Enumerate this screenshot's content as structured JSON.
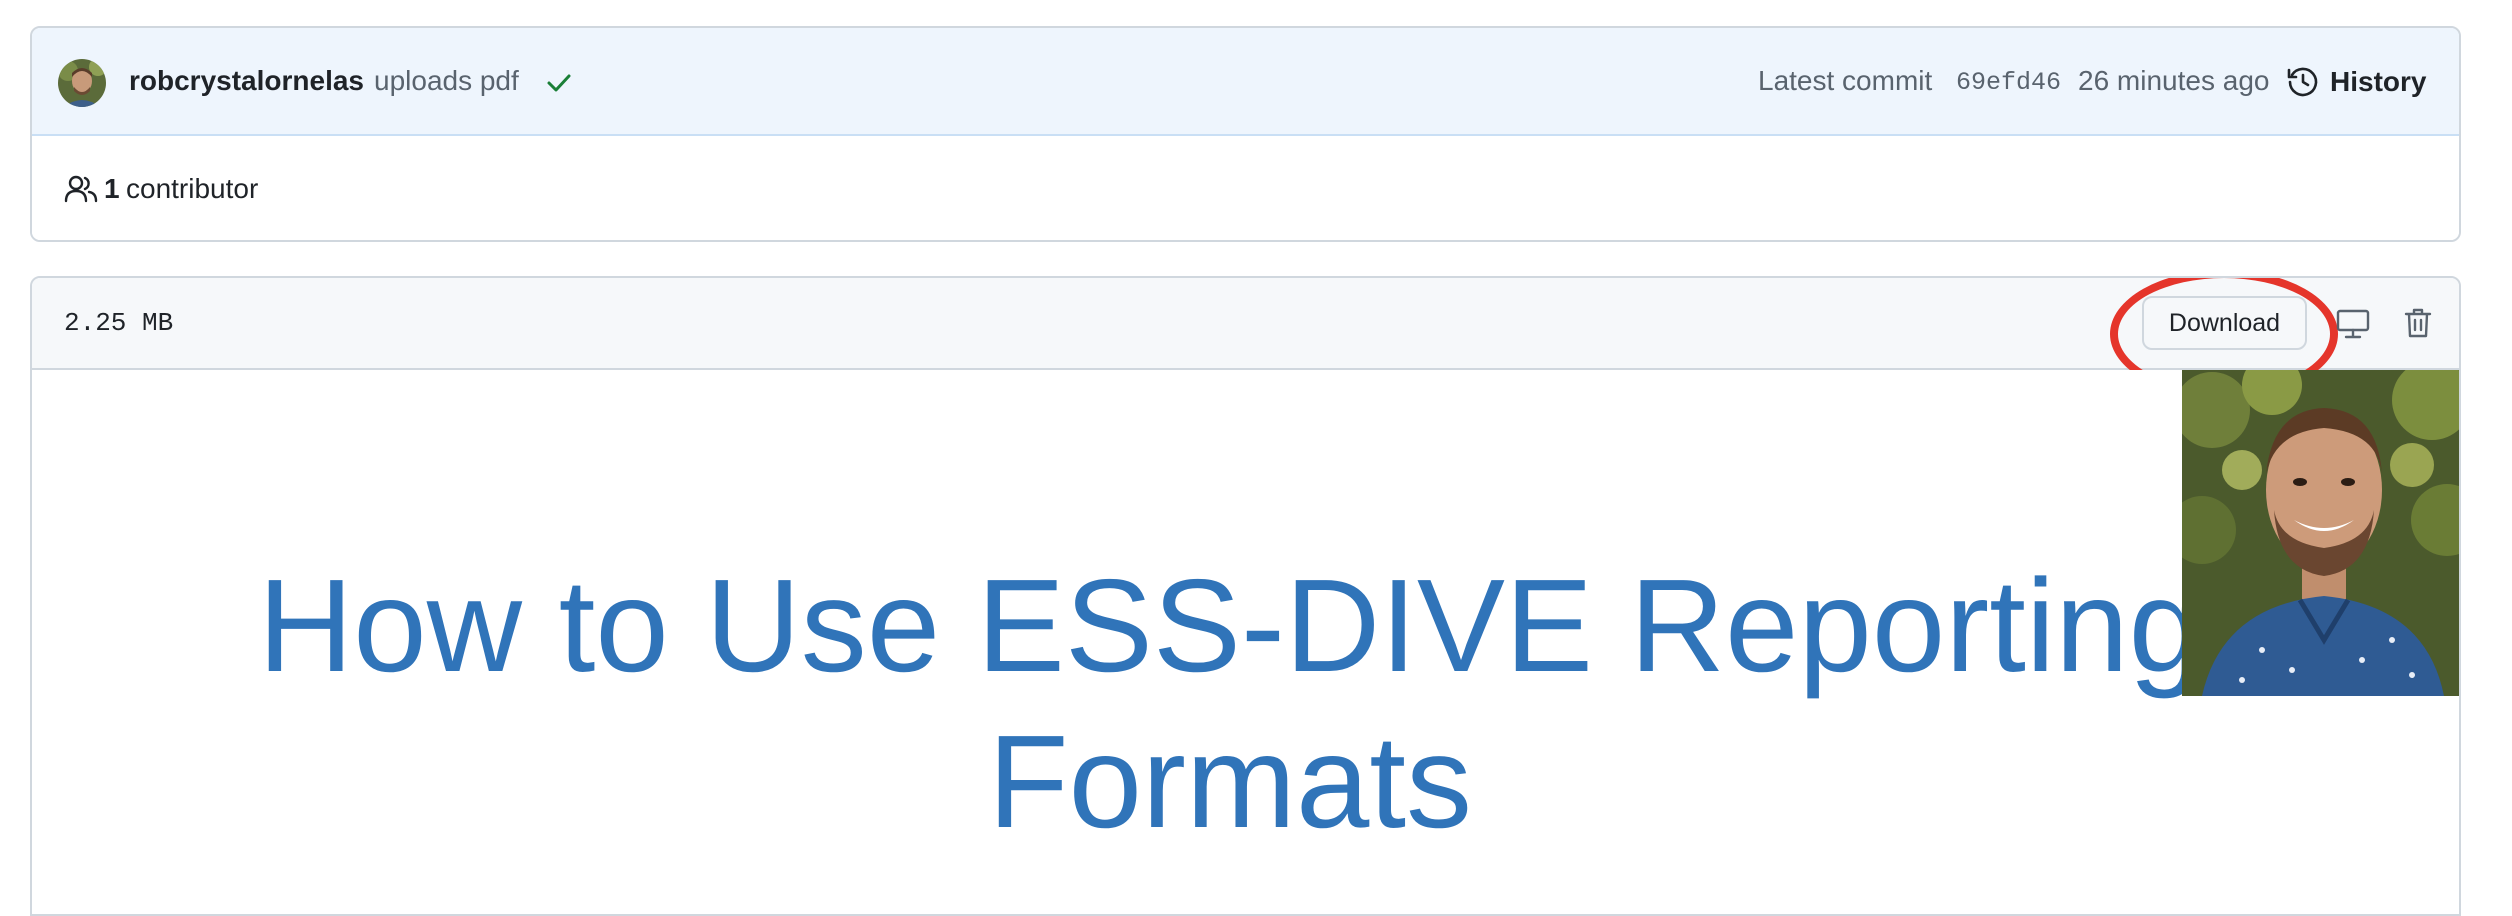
{
  "commit": {
    "author": "robcrystalornelas",
    "message": "uploads pdf",
    "latest_label": "Latest commit",
    "sha": "69efd46",
    "time": "26 minutes ago",
    "history_label": "History",
    "status": "success",
    "status_color": "#1a7f37"
  },
  "contributors": {
    "count": "1",
    "label": "contributor"
  },
  "file": {
    "size": "2.25 MB",
    "download_label": "Download",
    "actions": [
      "display-icon",
      "trash-icon"
    ]
  },
  "pdf": {
    "title_line1": "How to Use ESS-DIVE Reporting",
    "title_line2": "Formats",
    "title_color": "#3074b9"
  },
  "annotation": {
    "highlight_color": "#e5352b",
    "target": "Download"
  }
}
